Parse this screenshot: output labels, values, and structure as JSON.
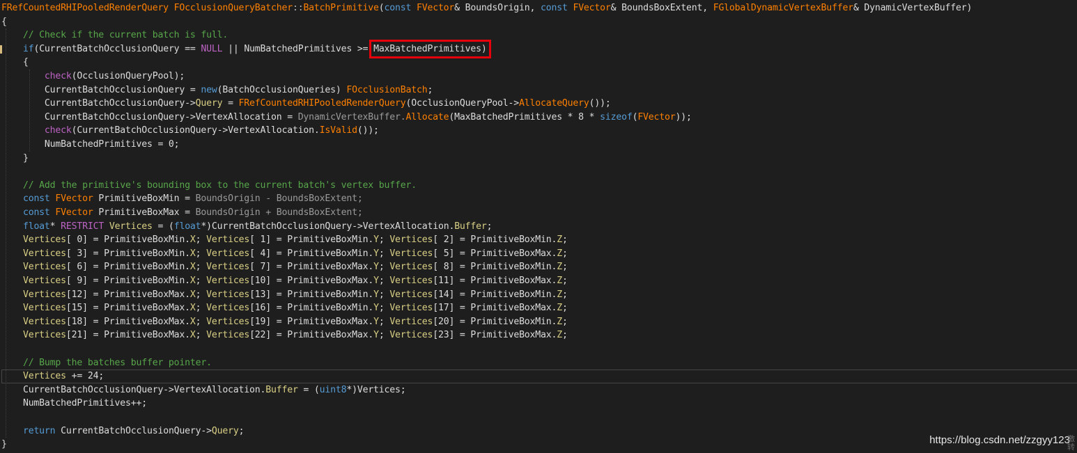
{
  "watermark": "https://blog.csdn.net/zzgyy123",
  "watermark_extra": [
    "激",
    "转"
  ],
  "highlight_token": "MaxBatchedPrimitives)",
  "lines": [
    [
      [
        "FRefCountedRHIPooledRenderQuery ",
        "type"
      ],
      [
        "FOcclusionQueryBatcher",
        "type"
      ],
      [
        "::",
        "op"
      ],
      [
        "BatchPrimitive",
        "func"
      ],
      [
        "(",
        "plain"
      ],
      [
        "const ",
        "keyword"
      ],
      [
        "FVector",
        "type"
      ],
      [
        "& BoundsOrigin, ",
        "plain"
      ],
      [
        "const ",
        "keyword"
      ],
      [
        "FVector",
        "type"
      ],
      [
        "& BoundsBoxExtent, ",
        "plain"
      ],
      [
        "FGlobalDynamicVertexBuffer",
        "type"
      ],
      [
        "& DynamicVertexBuffer)",
        "plain"
      ]
    ],
    [
      [
        "{",
        "plain"
      ]
    ],
    [
      [
        "    // Check if the current batch is full.",
        "comment"
      ]
    ],
    [
      [
        "    ",
        "plain"
      ],
      [
        "if",
        "keyword"
      ],
      [
        "(CurrentBatchOcclusionQuery == ",
        "plain"
      ],
      [
        "NULL",
        "nullconst"
      ],
      [
        " || NumBatchedPrimitives >= ",
        "plain"
      ],
      [
        "MaxBatchedPrimitives)",
        "plain"
      ]
    ],
    [
      [
        "    {",
        "plain"
      ]
    ],
    [
      [
        "        ",
        "plain"
      ],
      [
        "check",
        "macro"
      ],
      [
        "(OcclusionQueryPool);",
        "plain"
      ]
    ],
    [
      [
        "        CurrentBatchOcclusionQuery = ",
        "plain"
      ],
      [
        "new",
        "keyword"
      ],
      [
        "(BatchOcclusionQueries) ",
        "plain"
      ],
      [
        "FOcclusionBatch",
        "type"
      ],
      [
        ";",
        "plain"
      ]
    ],
    [
      [
        "        CurrentBatchOcclusionQuery->",
        "plain"
      ],
      [
        "Query",
        "member"
      ],
      [
        " = ",
        "plain"
      ],
      [
        "FRefCountedRHIPooledRenderQuery",
        "type"
      ],
      [
        "(OcclusionQueryPool->",
        "plain"
      ],
      [
        "AllocateQuery",
        "func"
      ],
      [
        "());",
        "plain"
      ]
    ],
    [
      [
        "        CurrentBatchOcclusionQuery->VertexAllocation = ",
        "plain"
      ],
      [
        "DynamicVertexBuffer.",
        "param"
      ],
      [
        "Allocate",
        "func"
      ],
      [
        "(MaxBatchedPrimitives * 8 * ",
        "plain"
      ],
      [
        "sizeof",
        "keyword"
      ],
      [
        "(",
        "plain"
      ],
      [
        "FVector",
        "type"
      ],
      [
        "));",
        "plain"
      ]
    ],
    [
      [
        "        ",
        "plain"
      ],
      [
        "check",
        "macro"
      ],
      [
        "(CurrentBatchOcclusionQuery->VertexAllocation.",
        "plain"
      ],
      [
        "IsValid",
        "func"
      ],
      [
        "());",
        "plain"
      ]
    ],
    [
      [
        "        NumBatchedPrimitives = 0;",
        "plain"
      ]
    ],
    [
      [
        "    }",
        "plain"
      ]
    ],
    [
      [
        "",
        "plain"
      ]
    ],
    [
      [
        "    // Add the primitive's bounding box to the current batch's vertex buffer.",
        "comment"
      ]
    ],
    [
      [
        "    ",
        "plain"
      ],
      [
        "const ",
        "keyword"
      ],
      [
        "FVector",
        "type"
      ],
      [
        " PrimitiveBoxMin = ",
        "plain"
      ],
      [
        "BoundsOrigin - BoundsBoxExtent;",
        "param"
      ]
    ],
    [
      [
        "    ",
        "plain"
      ],
      [
        "const ",
        "keyword"
      ],
      [
        "FVector",
        "type"
      ],
      [
        " PrimitiveBoxMax = ",
        "plain"
      ],
      [
        "BoundsOrigin + BoundsBoxExtent;",
        "param"
      ]
    ],
    [
      [
        "    ",
        "plain"
      ],
      [
        "float",
        "keyword"
      ],
      [
        "* ",
        "plain"
      ],
      [
        "RESTRICT",
        "macro"
      ],
      [
        " ",
        "plain"
      ],
      [
        "Vertices",
        "var"
      ],
      [
        " = (",
        "plain"
      ],
      [
        "float",
        "keyword"
      ],
      [
        "*)CurrentBatchOcclusionQuery->VertexAllocation.",
        "plain"
      ],
      [
        "Buffer",
        "member"
      ],
      [
        ";",
        "plain"
      ]
    ],
    [
      [
        "    ",
        "plain"
      ],
      [
        "Vertices",
        "var"
      ],
      [
        "[ 0] = PrimitiveBoxMin.",
        "plain"
      ],
      [
        "X",
        "member"
      ],
      [
        "; ",
        "plain"
      ],
      [
        "Vertices",
        "var"
      ],
      [
        "[ 1] = PrimitiveBoxMin.",
        "plain"
      ],
      [
        "Y",
        "member"
      ],
      [
        "; ",
        "plain"
      ],
      [
        "Vertices",
        "var"
      ],
      [
        "[ 2] = PrimitiveBoxMin.",
        "plain"
      ],
      [
        "Z",
        "member"
      ],
      [
        ";",
        "plain"
      ]
    ],
    [
      [
        "    ",
        "plain"
      ],
      [
        "Vertices",
        "var"
      ],
      [
        "[ 3] = PrimitiveBoxMin.",
        "plain"
      ],
      [
        "X",
        "member"
      ],
      [
        "; ",
        "plain"
      ],
      [
        "Vertices",
        "var"
      ],
      [
        "[ 4] = PrimitiveBoxMin.",
        "plain"
      ],
      [
        "Y",
        "member"
      ],
      [
        "; ",
        "plain"
      ],
      [
        "Vertices",
        "var"
      ],
      [
        "[ 5] = PrimitiveBoxMax.",
        "plain"
      ],
      [
        "Z",
        "member"
      ],
      [
        ";",
        "plain"
      ]
    ],
    [
      [
        "    ",
        "plain"
      ],
      [
        "Vertices",
        "var"
      ],
      [
        "[ 6] = PrimitiveBoxMin.",
        "plain"
      ],
      [
        "X",
        "member"
      ],
      [
        "; ",
        "plain"
      ],
      [
        "Vertices",
        "var"
      ],
      [
        "[ 7] = PrimitiveBoxMax.",
        "plain"
      ],
      [
        "Y",
        "member"
      ],
      [
        "; ",
        "plain"
      ],
      [
        "Vertices",
        "var"
      ],
      [
        "[ 8] = PrimitiveBoxMin.",
        "plain"
      ],
      [
        "Z",
        "member"
      ],
      [
        ";",
        "plain"
      ]
    ],
    [
      [
        "    ",
        "plain"
      ],
      [
        "Vertices",
        "var"
      ],
      [
        "[ 9] = PrimitiveBoxMin.",
        "plain"
      ],
      [
        "X",
        "member"
      ],
      [
        "; ",
        "plain"
      ],
      [
        "Vertices",
        "var"
      ],
      [
        "[10] = PrimitiveBoxMax.",
        "plain"
      ],
      [
        "Y",
        "member"
      ],
      [
        "; ",
        "plain"
      ],
      [
        "Vertices",
        "var"
      ],
      [
        "[11] = PrimitiveBoxMax.",
        "plain"
      ],
      [
        "Z",
        "member"
      ],
      [
        ";",
        "plain"
      ]
    ],
    [
      [
        "    ",
        "plain"
      ],
      [
        "Vertices",
        "var"
      ],
      [
        "[12] = PrimitiveBoxMax.",
        "plain"
      ],
      [
        "X",
        "member"
      ],
      [
        "; ",
        "plain"
      ],
      [
        "Vertices",
        "var"
      ],
      [
        "[13] = PrimitiveBoxMin.",
        "plain"
      ],
      [
        "Y",
        "member"
      ],
      [
        "; ",
        "plain"
      ],
      [
        "Vertices",
        "var"
      ],
      [
        "[14] = PrimitiveBoxMin.",
        "plain"
      ],
      [
        "Z",
        "member"
      ],
      [
        ";",
        "plain"
      ]
    ],
    [
      [
        "    ",
        "plain"
      ],
      [
        "Vertices",
        "var"
      ],
      [
        "[15] = PrimitiveBoxMax.",
        "plain"
      ],
      [
        "X",
        "member"
      ],
      [
        "; ",
        "plain"
      ],
      [
        "Vertices",
        "var"
      ],
      [
        "[16] = PrimitiveBoxMin.",
        "plain"
      ],
      [
        "Y",
        "member"
      ],
      [
        "; ",
        "plain"
      ],
      [
        "Vertices",
        "var"
      ],
      [
        "[17] = PrimitiveBoxMax.",
        "plain"
      ],
      [
        "Z",
        "member"
      ],
      [
        ";",
        "plain"
      ]
    ],
    [
      [
        "    ",
        "plain"
      ],
      [
        "Vertices",
        "var"
      ],
      [
        "[18] = PrimitiveBoxMax.",
        "plain"
      ],
      [
        "X",
        "member"
      ],
      [
        "; ",
        "plain"
      ],
      [
        "Vertices",
        "var"
      ],
      [
        "[19] = PrimitiveBoxMax.",
        "plain"
      ],
      [
        "Y",
        "member"
      ],
      [
        "; ",
        "plain"
      ],
      [
        "Vertices",
        "var"
      ],
      [
        "[20] = PrimitiveBoxMin.",
        "plain"
      ],
      [
        "Z",
        "member"
      ],
      [
        ";",
        "plain"
      ]
    ],
    [
      [
        "    ",
        "plain"
      ],
      [
        "Vertices",
        "var"
      ],
      [
        "[21] = PrimitiveBoxMax.",
        "plain"
      ],
      [
        "X",
        "member"
      ],
      [
        "; ",
        "plain"
      ],
      [
        "Vertices",
        "var"
      ],
      [
        "[22] = PrimitiveBoxMax.",
        "plain"
      ],
      [
        "Y",
        "member"
      ],
      [
        "; ",
        "plain"
      ],
      [
        "Vertices",
        "var"
      ],
      [
        "[23] = PrimitiveBoxMax.",
        "plain"
      ],
      [
        "Z",
        "member"
      ],
      [
        ";",
        "plain"
      ]
    ],
    [
      [
        "",
        "plain"
      ]
    ],
    [
      [
        "    // Bump the batches buffer pointer.",
        "comment"
      ]
    ],
    [
      [
        "    ",
        "plain"
      ],
      [
        "Vertices",
        "var"
      ],
      [
        " += 24;",
        "plain"
      ]
    ],
    [
      [
        "    CurrentBatchOcclusionQuery->VertexAllocation.",
        "plain"
      ],
      [
        "Buffer",
        "member"
      ],
      [
        " = (",
        "plain"
      ],
      [
        "uint8",
        "keyword"
      ],
      [
        "*)Vertices;",
        "plain"
      ]
    ],
    [
      [
        "    NumBatchedPrimitives++;",
        "plain"
      ]
    ],
    [
      [
        "",
        "plain"
      ]
    ],
    [
      [
        "    ",
        "plain"
      ],
      [
        "return ",
        "keyword"
      ],
      [
        "CurrentBatchOcclusionQuery->",
        "plain"
      ],
      [
        "Query",
        "member"
      ],
      [
        ";",
        "plain"
      ]
    ],
    [
      [
        "}",
        "plain"
      ]
    ]
  ]
}
